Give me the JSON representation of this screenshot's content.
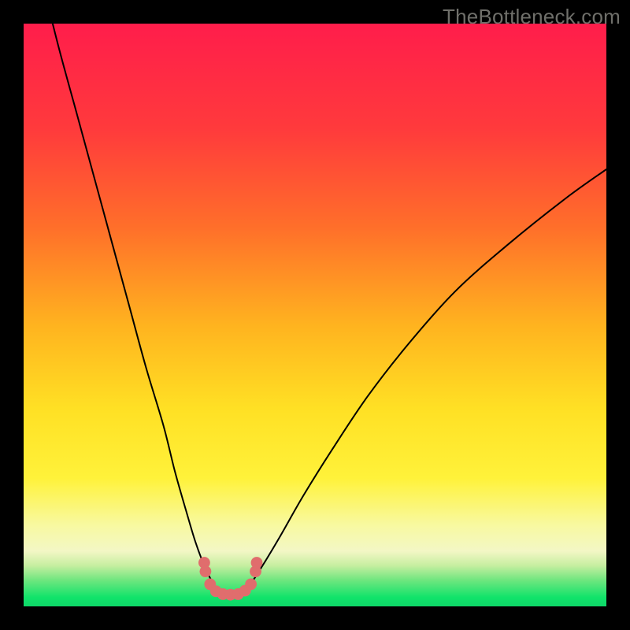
{
  "watermark": "TheBottleneck.com",
  "colors": {
    "frame": "#000000",
    "curve_stroke": "#000000",
    "marker_fill": "#e06d6d",
    "gradient_stops": [
      {
        "offset": 0.0,
        "color": "#ff1d4b"
      },
      {
        "offset": 0.18,
        "color": "#ff3a3c"
      },
      {
        "offset": 0.35,
        "color": "#ff6f2a"
      },
      {
        "offset": 0.52,
        "color": "#ffb41f"
      },
      {
        "offset": 0.66,
        "color": "#ffe024"
      },
      {
        "offset": 0.78,
        "color": "#fff23a"
      },
      {
        "offset": 0.86,
        "color": "#f8f9a0"
      },
      {
        "offset": 0.905,
        "color": "#f3f7c5"
      },
      {
        "offset": 0.93,
        "color": "#c6eea0"
      },
      {
        "offset": 0.955,
        "color": "#6fe67f"
      },
      {
        "offset": 0.985,
        "color": "#10e36a"
      },
      {
        "offset": 1.0,
        "color": "#0ed868"
      }
    ]
  },
  "chart_data": {
    "type": "line",
    "title": "",
    "xlabel": "",
    "ylabel": "",
    "xlim": [
      0,
      100
    ],
    "ylim": [
      0,
      100
    ],
    "grid": false,
    "legend": null,
    "series": [
      {
        "name": "bottleneck-curve",
        "x": [
          0,
          3,
          6,
          9,
          12,
          15,
          18,
          21,
          24,
          26,
          28,
          29.5,
          31,
          32.5,
          34,
          35.5,
          37,
          39,
          41,
          44,
          48,
          53,
          59,
          66,
          74,
          83,
          93,
          100
        ],
        "y": [
          120,
          108,
          96,
          85,
          74,
          63,
          52,
          41,
          31,
          23,
          16,
          11,
          7,
          4,
          2.5,
          2,
          2.4,
          4,
          7,
          12,
          19,
          27,
          36,
          45,
          54,
          62,
          70,
          75
        ]
      }
    ],
    "markers": [
      {
        "x": 31.0,
        "y": 7.5
      },
      {
        "x": 31.2,
        "y": 6.0
      },
      {
        "x": 32.0,
        "y": 3.8
      },
      {
        "x": 33.0,
        "y": 2.6
      },
      {
        "x": 34.2,
        "y": 2.1
      },
      {
        "x": 35.5,
        "y": 2.0
      },
      {
        "x": 36.8,
        "y": 2.1
      },
      {
        "x": 38.0,
        "y": 2.7
      },
      {
        "x": 39.0,
        "y": 3.8
      },
      {
        "x": 39.8,
        "y": 6.0
      },
      {
        "x": 40.0,
        "y": 7.5
      }
    ]
  }
}
